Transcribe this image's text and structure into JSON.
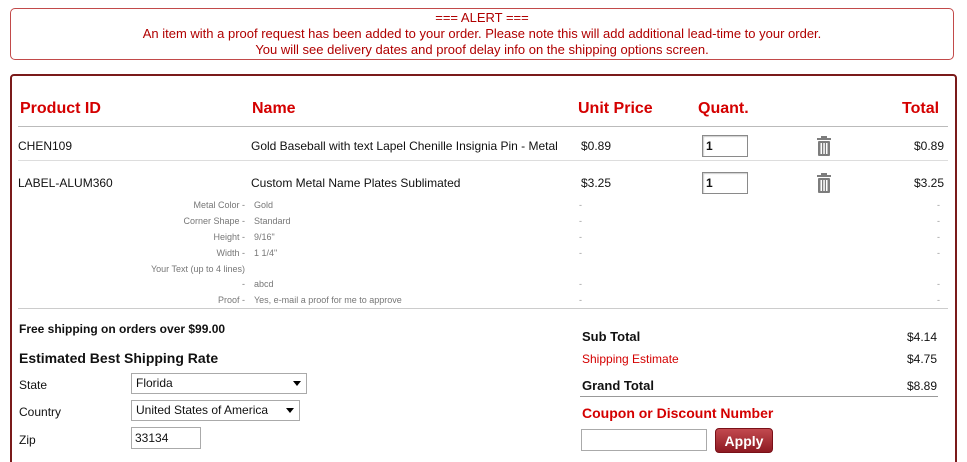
{
  "alert": {
    "title": "=== ALERT ===",
    "line1": "An item with a proof request has been added to your order. Please note this will add additional lead-time to your order.",
    "line2": "You will see delivery dates and proof delay info on the shipping options screen."
  },
  "headers": {
    "product_id": "Product ID",
    "name": "Name",
    "unit_price": "Unit Price",
    "quantity": "Quant.",
    "total": "Total"
  },
  "items": [
    {
      "product_id": "CHEN109",
      "name": "Gold Baseball with text Lapel Chenille Insignia Pin - Metal",
      "unit_price": "$0.89",
      "quantity": "1",
      "total": "$0.89"
    },
    {
      "product_id": "LABEL-ALUM360",
      "name": "Custom Metal Name Plates Sublimated",
      "unit_price": "$3.25",
      "quantity": "1",
      "total": "$3.25",
      "options": [
        {
          "label": "Metal Color -",
          "value": "Gold",
          "price": "-",
          "total": "-"
        },
        {
          "label": "Corner Shape -",
          "value": "Standard",
          "price": "-",
          "total": "-"
        },
        {
          "label": "Height -",
          "value": "9/16\"",
          "price": "-",
          "total": "-"
        },
        {
          "label": "Width -",
          "value": "1 1/4\"",
          "price": "-",
          "total": "-"
        },
        {
          "label": "Your Text (up to 4 lines)",
          "value": "",
          "price": "",
          "total": ""
        },
        {
          "label": "-",
          "value": "abcd",
          "price": "-",
          "total": "-"
        },
        {
          "label": "Proof -",
          "value": "Yes, e-mail a proof for me to approve",
          "price": "-",
          "total": "-"
        }
      ]
    }
  ],
  "shipping": {
    "free_notice": "Free shipping on orders over $99.00",
    "heading": "Estimated Best Shipping Rate",
    "state_label": "State",
    "state_value": "Florida",
    "country_label": "Country",
    "country_value": "United States of America",
    "zip_label": "Zip",
    "zip_value": "33134"
  },
  "summary": {
    "subtotal_label": "Sub Total",
    "subtotal_value": "$4.14",
    "shipping_label": "Shipping Estimate",
    "shipping_value": "$4.75",
    "grand_label": "Grand Total",
    "grand_value": "$8.89",
    "coupon_label": "Coupon or Discount Number",
    "coupon_value": "",
    "apply_label": "Apply"
  },
  "icons": {
    "delete": "trash-icon"
  },
  "colors": {
    "accent": "#d40000",
    "border": "#7a1a1a",
    "button": "#a52a30"
  }
}
